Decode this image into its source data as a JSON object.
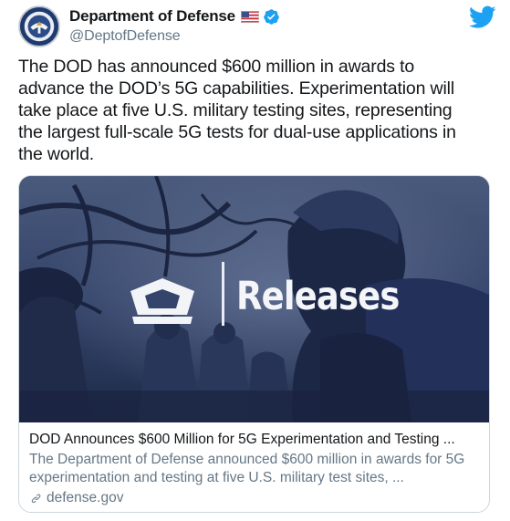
{
  "account": {
    "display_name": "Department of Defense",
    "handle": "@DeptofDefense",
    "verified": true,
    "flag_icon": "us-flag-icon",
    "platform_icon": "twitter-bird-icon"
  },
  "tweet": {
    "text": "The DOD has announced $600 million in awards to\nadvance the DOD’s 5G capabilities. Experimentation will\ntake place at five U.S. military testing sites, representing\nthe largest full-scale 5G tests for dual-use applications in\nthe world."
  },
  "card": {
    "image_label": "Releases",
    "title": "DOD Announces $600 Million for 5G Experimentation and Testing ...",
    "description": "The Department of Defense announced $600 million in awards for 5G experimentation and testing at five U.S. military test sites, ...",
    "domain": "defense.gov",
    "link_icon": "link-icon"
  },
  "colors": {
    "twitter_blue": "#1da1f2",
    "text_primary": "#14171a",
    "text_secondary": "#657786",
    "card_border": "#ccd6dd"
  }
}
